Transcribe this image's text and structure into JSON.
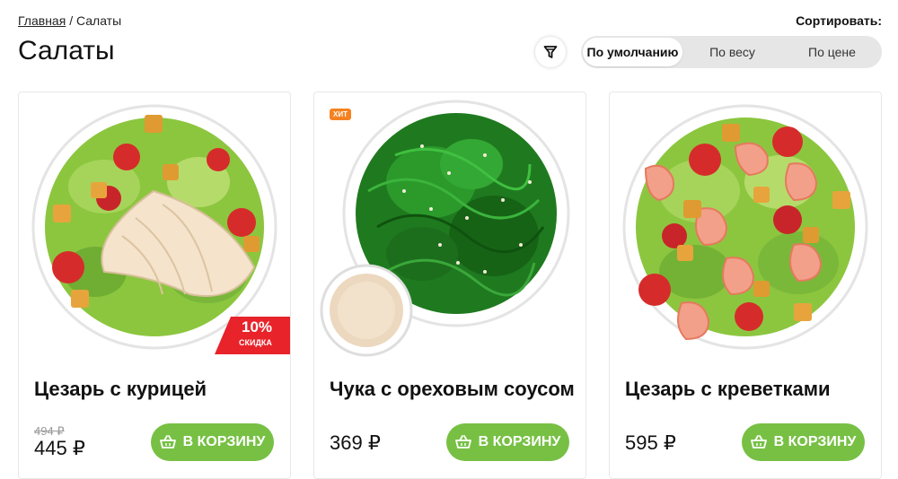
{
  "breadcrumb": {
    "home": "Главная",
    "separator": "/",
    "current": "Салаты"
  },
  "page_title": "Салаты",
  "sort": {
    "label": "Сортировать:",
    "options": [
      "По умолчанию",
      "По весу",
      "По цене"
    ],
    "selected": "По умолчанию"
  },
  "filter_icon": "filter-icon",
  "products": [
    {
      "name": "Цезарь с курицей",
      "old_price": "494 ₽",
      "price": "445 ₽",
      "button": "В КОРЗИНУ",
      "discount_pct": "10%",
      "discount_label": "СКИДКА"
    },
    {
      "name": "Чука с ореховым соусом",
      "price": "369 ₽",
      "button": "В КОРЗИНУ",
      "badge": "ХИТ"
    },
    {
      "name": "Цезарь с креветками",
      "price": "595 ₽",
      "button": "В КОРЗИНУ"
    }
  ],
  "colors": {
    "accent": "#77c044",
    "badge_hit": "#f58220",
    "discount": "#e8232a"
  }
}
